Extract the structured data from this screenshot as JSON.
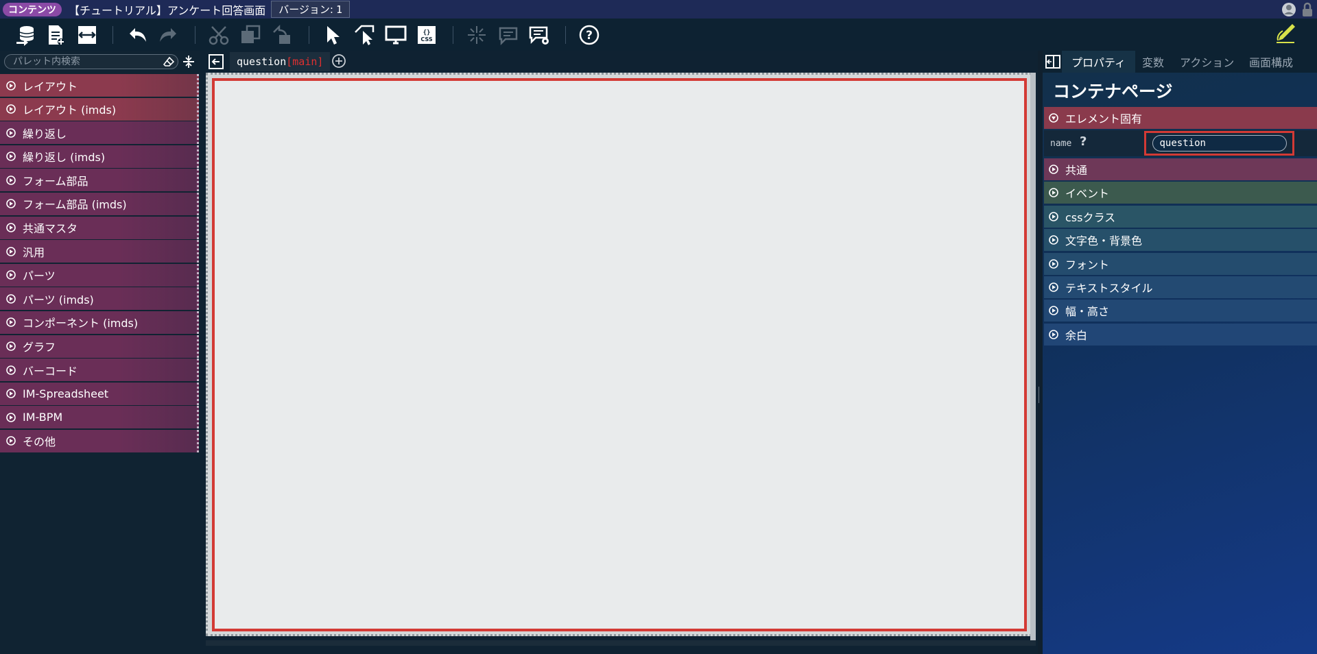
{
  "titlebar": {
    "badge": "コンテンツ",
    "title": "【チュートリアル】アンケート回答画面",
    "version_label": "バージョン:",
    "version_number": "1"
  },
  "toolbar": {
    "icons": [
      "database-arrow-icon",
      "new-sheet-icon",
      "page-swap-icon",
      "undo-icon",
      "redo-icon",
      "cut-icon",
      "copy-icon",
      "paste-icon",
      "select-pointer-icon",
      "select-region-icon",
      "preview-monitor-icon",
      "css-icon",
      "sparkle-icon",
      "comment-icon",
      "comment-settings-icon",
      "help-icon",
      "edit-pencil-icon"
    ]
  },
  "palette": {
    "search_placeholder": "パレット内検索",
    "items": [
      {
        "label": "レイアウト",
        "color": "#8c3a4e"
      },
      {
        "label": "レイアウト (imds)",
        "color": "#8c3a4e"
      },
      {
        "label": "繰り返し",
        "color": "#6a2e57"
      },
      {
        "label": "繰り返し (imds)",
        "color": "#6a2e57"
      },
      {
        "label": "フォーム部品",
        "color": "#6a2e57"
      },
      {
        "label": "フォーム部品 (imds)",
        "color": "#6a2e57"
      },
      {
        "label": "共通マスタ",
        "color": "#6a2e57"
      },
      {
        "label": "汎用",
        "color": "#6a2e57"
      },
      {
        "label": "パーツ",
        "color": "#6a2e57"
      },
      {
        "label": "パーツ (imds)",
        "color": "#6a2e57"
      },
      {
        "label": "コンポーネント (imds)",
        "color": "#6a2e57"
      },
      {
        "label": "グラフ",
        "color": "#6a2e57"
      },
      {
        "label": "バーコード",
        "color": "#6a2e57"
      },
      {
        "label": "IM-Spreadsheet",
        "color": "#6a2e57"
      },
      {
        "label": "IM-BPM",
        "color": "#6a2e57"
      },
      {
        "label": "その他",
        "color": "#6a2e57"
      }
    ]
  },
  "editor": {
    "tab_name": "question",
    "tab_suffix": "[main]"
  },
  "properties": {
    "tabs": [
      "プロパティ",
      "変数",
      "アクション",
      "画面構成"
    ],
    "title": "コンテナページ",
    "element_section": "エレメント固有",
    "name_label": "name",
    "help": "?",
    "name_value": "question",
    "sections": [
      {
        "label": "共通",
        "color": "#6e3858"
      },
      {
        "label": "イベント",
        "color": "#3c5a4e"
      },
      {
        "label": "cssクラス",
        "color": "#2a5566"
      },
      {
        "label": "文字色・背景色",
        "color": "#26506a"
      },
      {
        "label": "フォント",
        "color": "#244c6e"
      },
      {
        "label": "テキストスタイル",
        "color": "#234a72"
      },
      {
        "label": "幅・高さ",
        "color": "#224874"
      },
      {
        "label": "余白",
        "color": "#214676"
      }
    ]
  },
  "colors": {
    "element_section": "#8a3a4c",
    "highlight": "#d33a35",
    "accent_pencil": "#d8e24a"
  }
}
